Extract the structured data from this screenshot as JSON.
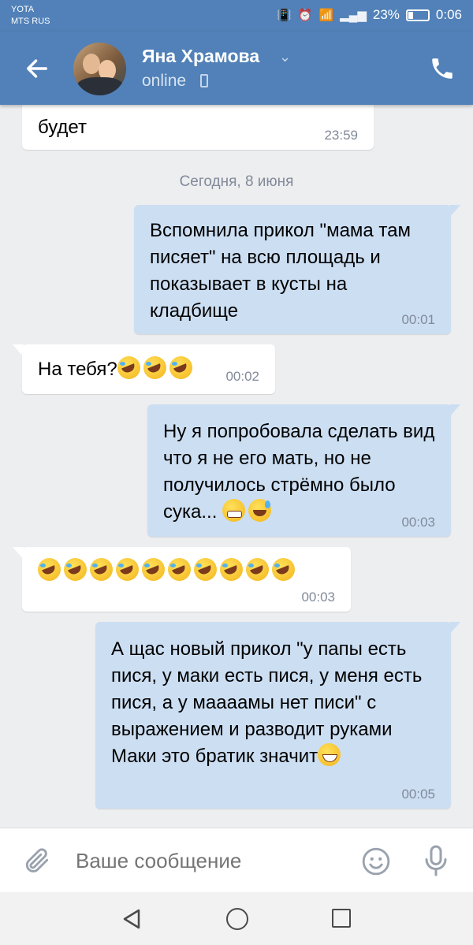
{
  "status_bar": {
    "carrier_1": "YOTA",
    "carrier_2": "MTS RUS",
    "battery": "23%",
    "time": "0:06"
  },
  "header": {
    "contact_name": "Яна Храмова",
    "status": "online",
    "back_icon": "arrow-left-icon",
    "call_icon": "phone-icon"
  },
  "messages": [
    {
      "direction": "in",
      "text": "будет",
      "time": "23:59"
    },
    {
      "direction": "out",
      "text": "Вспомнила прикол \"мама там писяет\" на всю площадь и показывает в кусты на кладбище",
      "time": "00:01"
    },
    {
      "direction": "in",
      "text": "На тебя?",
      "emoji": [
        "rofl",
        "rofl",
        "rofl"
      ],
      "time": "00:02"
    },
    {
      "direction": "out",
      "text": "Ну я попробовала сделать вид что я не его мать, но не получилось стрёмно было сука...",
      "emoji": [
        "grimacing",
        "sweat-smile"
      ],
      "time": "00:03"
    },
    {
      "direction": "in",
      "text": "",
      "emoji": [
        "rofl",
        "rofl",
        "rofl",
        "rofl",
        "rofl",
        "rofl",
        "rofl",
        "rofl",
        "rofl",
        "rofl"
      ],
      "time": "00:03"
    },
    {
      "direction": "out",
      "text": "А щас новый прикол \"у папы есть пися, у маки есть пися, у меня есть пися, а у маааамы нет писи\" с выражением и разводит руками\nМаки это братик значит",
      "emoji": [
        "grin"
      ],
      "time": "00:05"
    }
  ],
  "date_separator": "Сегодня, 8 июня",
  "composer": {
    "placeholder": "Ваше сообщение",
    "attach_icon": "paperclip-icon",
    "emoji_icon": "smile-icon",
    "mic_icon": "microphone-icon"
  },
  "nav": {
    "back_icon": "triangle-back-icon",
    "home_icon": "circle-home-icon",
    "recent_icon": "square-recent-icon"
  },
  "colors": {
    "header": "#5181b8",
    "outgoing_bubble": "#ccdef2",
    "incoming_bubble": "#ffffff",
    "chat_bg": "#edeef0",
    "time_text": "#828a99"
  }
}
